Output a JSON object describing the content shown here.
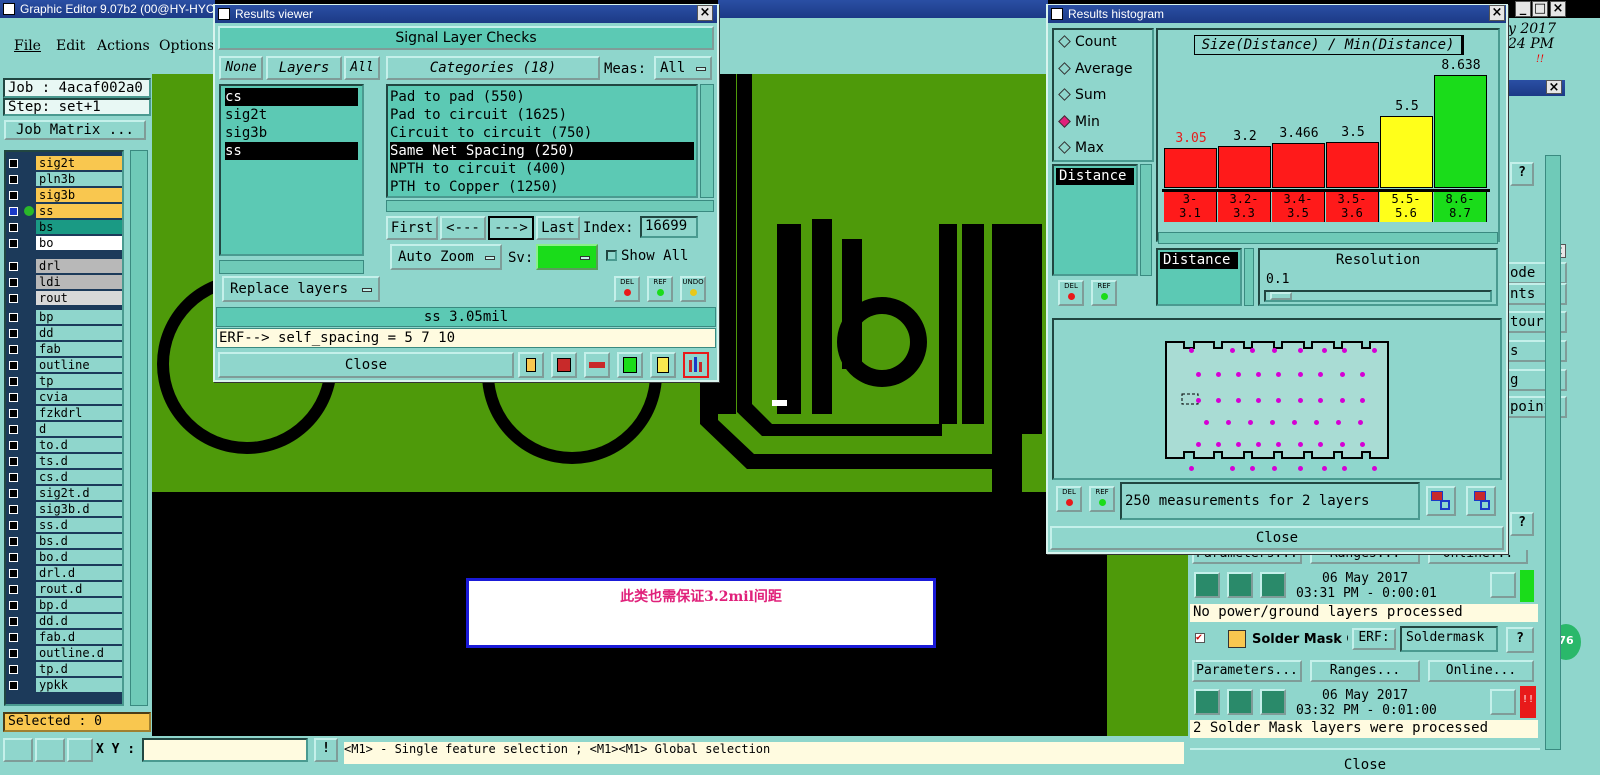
{
  "app": {
    "title": "Graphic Editor 9.07b2 (00@HY-HYC",
    "menu": [
      "File",
      "Edit",
      "Actions",
      "Options"
    ],
    "clock_line1": "y 2017",
    "clock_line2": "24 PM"
  },
  "job": {
    "label": "Job : 4acaf002a0",
    "step": "Step: set+1",
    "matrix_button": "Job Matrix ...",
    "selected": "Selected : 0"
  },
  "layers": [
    {
      "name": "sig2t",
      "color": "#f9c74f"
    },
    {
      "name": "pln3b",
      "color": "#8fd6cc"
    },
    {
      "name": "sig3b",
      "color": "#f9c74f"
    },
    {
      "name": "ss",
      "color": "#f9c74f"
    },
    {
      "name": "bs",
      "color": "#1a9a84"
    },
    {
      "name": "bo",
      "color": "#ffffff"
    },
    {
      "name": "drl",
      "color": "#b8b8b8"
    },
    {
      "name": "ldi",
      "color": "#b8b8b8"
    },
    {
      "name": "rout",
      "color": "#d8d8d8"
    },
    {
      "name": "bp",
      "color": "#8fd6cc"
    },
    {
      "name": "dd",
      "color": "#8fd6cc"
    },
    {
      "name": "fab",
      "color": "#8fd6cc"
    },
    {
      "name": "outline",
      "color": "#8fd6cc"
    },
    {
      "name": "tp",
      "color": "#8fd6cc"
    },
    {
      "name": "cvia",
      "color": "#8fd6cc"
    },
    {
      "name": "fzkdrl",
      "color": "#8fd6cc"
    },
    {
      "name": "d",
      "color": "#8fd6cc"
    },
    {
      "name": "to.d",
      "color": "#8fd6cc"
    },
    {
      "name": "ts.d",
      "color": "#8fd6cc"
    },
    {
      "name": "cs.d",
      "color": "#8fd6cc"
    },
    {
      "name": "sig2t.d",
      "color": "#8fd6cc"
    },
    {
      "name": "sig3b.d",
      "color": "#8fd6cc"
    },
    {
      "name": "ss.d",
      "color": "#8fd6cc"
    },
    {
      "name": "bs.d",
      "color": "#8fd6cc"
    },
    {
      "name": "bo.d",
      "color": "#8fd6cc"
    },
    {
      "name": "drl.d",
      "color": "#8fd6cc"
    },
    {
      "name": "rout.d",
      "color": "#8fd6cc"
    },
    {
      "name": "bp.d",
      "color": "#8fd6cc"
    },
    {
      "name": "dd.d",
      "color": "#8fd6cc"
    },
    {
      "name": "fab.d",
      "color": "#8fd6cc"
    },
    {
      "name": "outline.d",
      "color": "#8fd6cc"
    },
    {
      "name": "tp.d",
      "color": "#8fd6cc"
    },
    {
      "name": "ypkk",
      "color": "#8fd6cc"
    }
  ],
  "viewer": {
    "title": "Results viewer",
    "heading": "Signal Layer Checks",
    "none": "None",
    "layers_btn": "Layers",
    "all": "All",
    "categories_btn": "Categories (18)",
    "meas_label": "Meas:",
    "meas_value": "All",
    "layer_list": [
      "cs",
      "sig2t",
      "sig3b",
      "ss"
    ],
    "category_list": [
      "Pad to pad (550)",
      "Pad to circuit (1625)",
      "Circuit to circuit (750)",
      "Same Net Spacing (250)",
      "NPTH to circuit (400)",
      "PTH to Copper (1250)"
    ],
    "first": "First",
    "prev": "<---",
    "next": "--->",
    "last": "Last",
    "index_label": "Index:",
    "index_value": "16699",
    "auto_zoom": "Auto Zoom",
    "sv_label": "Sv:",
    "show_all": "Show All",
    "replace_layers": "Replace layers",
    "del": "DEL",
    "ref": "REF",
    "undo": "UNDO",
    "result": "ss 3.05mil",
    "erf": "ERF--> self_spacing = 5 7 10",
    "close": "Close"
  },
  "histogram": {
    "title": "Results histogram",
    "radios": [
      "Count",
      "Average",
      "Sum",
      "Min",
      "Max"
    ],
    "selected_radio": "Min",
    "list_item": "Distance",
    "chart_title": "Size(Distance) / Min(Distance)",
    "x_selector": "Distance",
    "resolution_label": "Resolution",
    "resolution_value": "0.1",
    "del": "DEL",
    "ref": "REF",
    "summary": "250 measurements for 2 layers",
    "close": "Close"
  },
  "chart_data": {
    "type": "bar",
    "title": "Size(Distance) / Min(Distance)",
    "categories": [
      "3-3.1",
      "3.2-3.3",
      "3.4-3.5",
      "3.5-3.6",
      "5.5-5.6",
      "8.6-8.7"
    ],
    "category_labels": [
      [
        "3-",
        "3.1"
      ],
      [
        "3.2-",
        "3.3"
      ],
      [
        "3.4-",
        "3.5"
      ],
      [
        "3.5-",
        "3.6"
      ],
      [
        "5.5-",
        "5.6"
      ],
      [
        "8.6-",
        "8.7"
      ]
    ],
    "values": [
      3.05,
      3.2,
      3.466,
      3.5,
      5.5,
      8.638
    ],
    "value_labels": [
      "3.05",
      "3.2",
      "3.466",
      "3.5",
      "5.5",
      "8.638"
    ],
    "colors": [
      "#ff1a1a",
      "#ff1a1a",
      "#ff1a1a",
      "#ff1a1a",
      "#ffff1a",
      "#1adc1a"
    ],
    "ylim": [
      0,
      9.5
    ]
  },
  "checklist": {
    "parameters": "Parameters...",
    "ranges": "Ranges...",
    "online": "Online...",
    "date1": "06 May 2017",
    "time1": "03:31 PM - 0:00:01",
    "msg1": "No power/ground layers processed",
    "solder_mask": "Solder Mask Ch",
    "erf_label": "ERF:",
    "erf_value": "Soldermask",
    "date2": "06 May 2017",
    "time2": "03:32 PM - 0:01:00",
    "msg2": "2 Solder Mask layers were processed",
    "help": "?",
    "right_items": [
      "ode",
      "nts",
      "tours",
      "s",
      "g",
      "points"
    ],
    "badge": "76",
    "close": "Close"
  },
  "annotation": {
    "text": "此类也需保证3.2mil间距"
  },
  "status": {
    "xy_label": "X Y :",
    "hint": "<M1> - Single feature selection ; <M1><M1> Global selection"
  }
}
